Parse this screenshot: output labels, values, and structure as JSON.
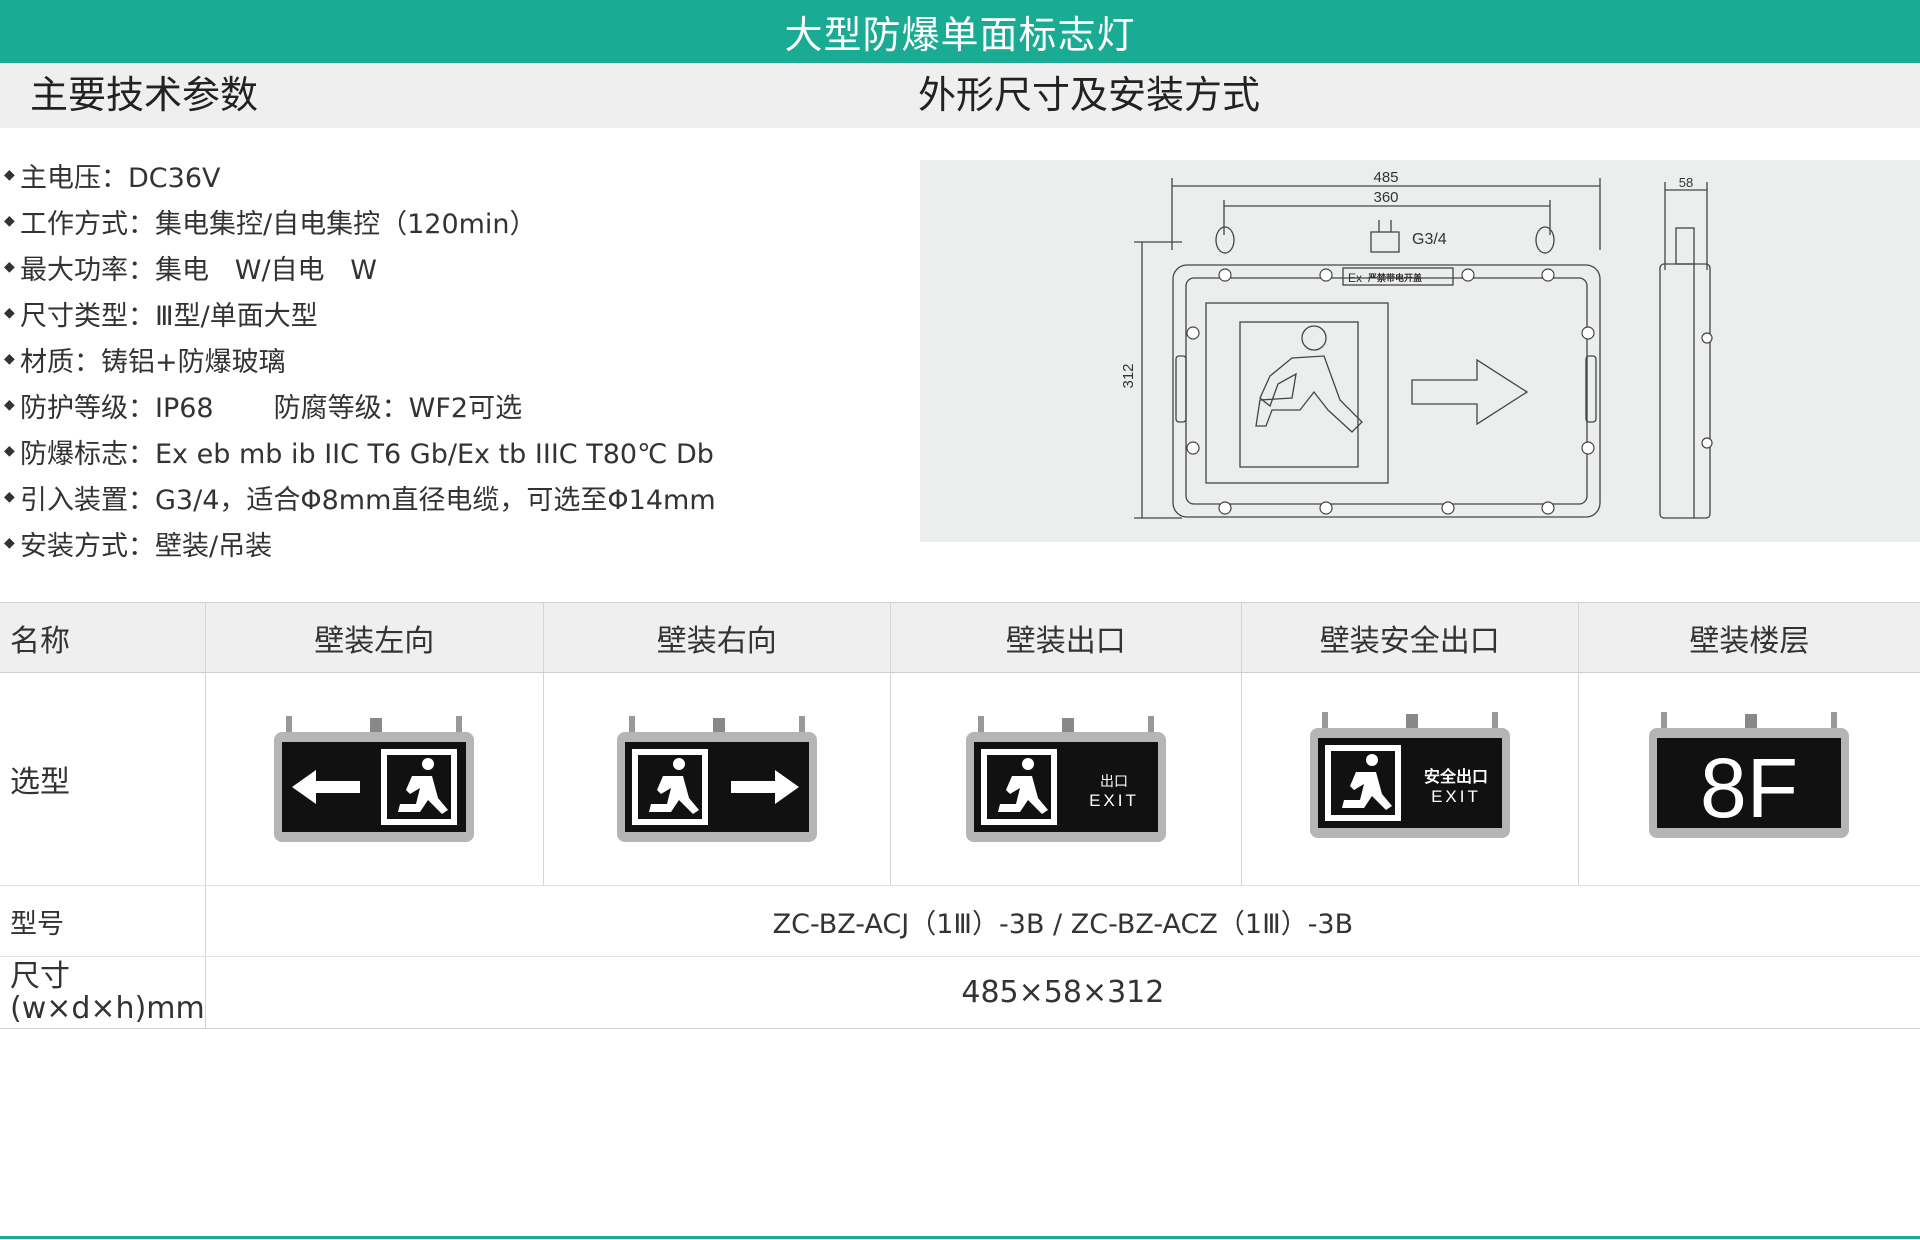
{
  "title": "大型防爆单面标志灯",
  "sections": {
    "left": "主要技术参数",
    "right": "外形尺寸及安装方式"
  },
  "params": [
    "主电压：DC36V",
    "工作方式：集电集控/自电集控（120min）",
    "最大功率：集电   W/自电   W",
    "尺寸类型：Ⅲ型/单面大型",
    "材质：铸铝+防爆玻璃",
    "防护等级：IP68       防腐等级：WF2可选",
    "防爆标志：Ex eb mb ib IIC T6 Gb/Ex tb IIIC T80℃ Db",
    "引入装置：G3/4，适合Φ8mm直径电缆，可选至Φ14mm",
    "安装方式：壁装/吊装"
  ],
  "drawing": {
    "width_outer": "485",
    "width_inner": "360",
    "depth": "58",
    "height": "312",
    "thread": "G3/4",
    "label_ex": "Ex",
    "label_plate": "严禁带电开盖"
  },
  "table": {
    "header": {
      "name": "名称",
      "cols": [
        "壁装左向",
        "壁装右向",
        "壁装出口",
        "壁装安全出口",
        "壁装楼层"
      ]
    },
    "row_select": "选型",
    "row_model": "型号",
    "model_value": "ZC-BZ-ACJ（1Ⅲ）-3B / ZC-BZ-ACZ（1Ⅲ）-3B",
    "row_size": "尺寸\n(w×d×h)mm",
    "size_value": "485×58×312"
  },
  "sign_texts": {
    "exit_cn": "出口",
    "exit_en": "EXIT",
    "safe_exit_cn": "安全出口",
    "floor": "8F"
  },
  "colors": {
    "accent": "#1aab94",
    "header_bg": "#efefef",
    "drawing_bg": "#eceeee"
  }
}
